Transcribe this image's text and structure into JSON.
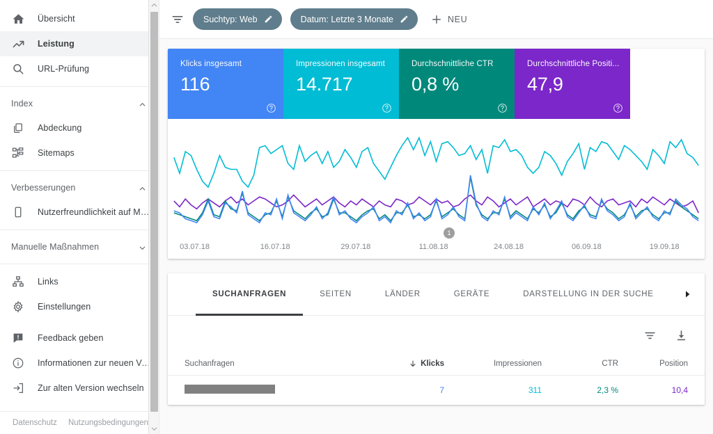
{
  "colors": {
    "clicks": "#4285F4",
    "impressions": "#00BCD4",
    "ctr": "#00897B",
    "position": "#7B27C9",
    "chip": "#5f7d8c",
    "sidebar_selected": "#f1f3f4"
  },
  "sidebar": {
    "items": [
      {
        "label": "Übersicht",
        "icon": "home-icon",
        "selected": false
      },
      {
        "label": "Leistung",
        "icon": "trending-up-icon",
        "selected": true
      },
      {
        "label": "URL-Prüfung",
        "icon": "search-icon",
        "selected": false
      }
    ],
    "groups": [
      {
        "title": "Index",
        "expanded": true,
        "items": [
          {
            "label": "Abdeckung",
            "icon": "pages-icon"
          },
          {
            "label": "Sitemaps",
            "icon": "sitemap-icon"
          }
        ]
      },
      {
        "title": "Verbesserungen",
        "expanded": true,
        "items": [
          {
            "label": "Nutzerfreundlichkeit auf Mo...",
            "icon": "mobile-icon"
          }
        ]
      },
      {
        "title": "Manuelle Maßnahmen",
        "expanded": false,
        "items": []
      }
    ],
    "bottom_items": [
      {
        "label": "Links",
        "icon": "links-icon"
      },
      {
        "label": "Einstellungen",
        "icon": "gear-icon"
      },
      {
        "label": "Feedback geben",
        "icon": "feedback-icon"
      },
      {
        "label": "Informationen zur neuen Ver...",
        "icon": "info-icon"
      },
      {
        "label": "Zur alten Version wechseln",
        "icon": "exit-icon"
      }
    ],
    "footer": {
      "privacy": "Datenschutz",
      "terms": "Nutzungsbedingungen"
    }
  },
  "filterbar": {
    "filter_icon": "filter-icon",
    "chips": [
      {
        "label": "Suchtyp: Web",
        "edit_icon": "pencil-icon"
      },
      {
        "label": "Datum: Letzte 3 Monate",
        "edit_icon": "pencil-icon"
      }
    ],
    "new_button": {
      "label": "NEU",
      "icon": "plus-icon"
    }
  },
  "metrics": [
    {
      "label": "Klicks insgesamt",
      "value": "116",
      "color": "#4285F4",
      "help_icon": "help-icon"
    },
    {
      "label": "Impressionen insgesamt",
      "value": "14.717",
      "color": "#00BCD4",
      "help_icon": "help-icon"
    },
    {
      "label": "Durchschnittliche CTR",
      "value": "0,8 %",
      "color": "#00897B",
      "help_icon": "help-icon"
    },
    {
      "label": "Durchschnittliche Positi...",
      "value": "47,9",
      "color": "#7B27C9",
      "help_icon": "help-icon"
    }
  ],
  "chart_data": {
    "type": "line",
    "title": "",
    "xlabel": "",
    "ylabel": "",
    "grid": false,
    "legend_position": "none",
    "annotations": [
      {
        "label": "1",
        "x_index": 53
      }
    ],
    "tick_labels": [
      "03.07.18",
      "16.07.18",
      "29.07.18",
      "11.08.18",
      "24.08.18",
      "06.09.18",
      "19.09.18"
    ],
    "tick_positions_pct": [
      5.0,
      20.0,
      35.0,
      49.5,
      63.5,
      78.0,
      92.5
    ],
    "series": [
      {
        "name": "Impressionen",
        "color": "#00BCD4",
        "values": [
          68,
          52,
          74,
          70,
          56,
          44,
          38,
          52,
          70,
          58,
          56,
          56,
          44,
          38,
          50,
          78,
          80,
          72,
          76,
          80,
          62,
          56,
          80,
          64,
          70,
          74,
          62,
          74,
          58,
          64,
          76,
          68,
          58,
          74,
          78,
          62,
          54,
          46,
          58,
          70,
          80,
          88,
          76,
          88,
          70,
          84,
          64,
          82,
          84,
          78,
          70,
          72,
          80,
          66,
          76,
          52,
          80,
          78,
          86,
          74,
          76,
          70,
          58,
          52,
          58,
          74,
          70,
          62,
          50,
          64,
          72,
          82,
          56,
          78,
          74,
          84,
          82,
          74,
          66,
          80,
          76,
          70,
          64,
          56,
          76,
          70,
          62,
          84,
          78,
          86,
          72,
          68,
          60
        ]
      },
      {
        "name": "Position",
        "color": "#7B27C9",
        "values": [
          24,
          18,
          26,
          20,
          16,
          22,
          26,
          22,
          18,
          24,
          28,
          22,
          26,
          20,
          24,
          28,
          26,
          22,
          18,
          20,
          24,
          30,
          24,
          18,
          22,
          26,
          20,
          24,
          28,
          22,
          18,
          24,
          20,
          26,
          22,
          18,
          24,
          20,
          18,
          26,
          24,
          20,
          22,
          28,
          24,
          20,
          26,
          22,
          24,
          18,
          20,
          26,
          30,
          24,
          20,
          28,
          24,
          18,
          22,
          26,
          20,
          24,
          28,
          18,
          22,
          26,
          20,
          24,
          22,
          18,
          26,
          24,
          20,
          28,
          22,
          18,
          24,
          26,
          20,
          22,
          24,
          18,
          26,
          22,
          28,
          24,
          20,
          26,
          22,
          18,
          20,
          24,
          12
        ]
      },
      {
        "name": "Klicks",
        "color": "#4285F4",
        "values": [
          14,
          12,
          6,
          4,
          2,
          10,
          24,
          8,
          6,
          22,
          18,
          12,
          34,
          10,
          6,
          2,
          12,
          10,
          26,
          6,
          30,
          12,
          8,
          4,
          10,
          18,
          6,
          12,
          28,
          10,
          14,
          6,
          2,
          8,
          12,
          18,
          4,
          8,
          2,
          14,
          10,
          22,
          6,
          12,
          4,
          8,
          26,
          6,
          10,
          18,
          8,
          4,
          50,
          22,
          8,
          4,
          14,
          10,
          28,
          6,
          12,
          8,
          4,
          18,
          10,
          22,
          6,
          14,
          24,
          8,
          4,
          12,
          20,
          8,
          6,
          26,
          14,
          10,
          4,
          8,
          22,
          6,
          12,
          18,
          8,
          4,
          14,
          10,
          26,
          20,
          16,
          8,
          4
        ]
      },
      {
        "name": "CTR",
        "color": "#00897B",
        "values": [
          12,
          10,
          8,
          6,
          4,
          12,
          26,
          10,
          8,
          24,
          16,
          14,
          32,
          12,
          8,
          4,
          10,
          12,
          24,
          8,
          28,
          14,
          10,
          6,
          12,
          16,
          8,
          10,
          26,
          12,
          12,
          8,
          4,
          10,
          14,
          16,
          6,
          10,
          4,
          12,
          12,
          20,
          8,
          10,
          6,
          10,
          24,
          8,
          12,
          16,
          10,
          6,
          48,
          20,
          10,
          6,
          12,
          12,
          26,
          8,
          14,
          10,
          6,
          16,
          12,
          20,
          8,
          12,
          22,
          10,
          6,
          14,
          18,
          10,
          8,
          24,
          16,
          12,
          6,
          10,
          20,
          8,
          14,
          16,
          10,
          6,
          12,
          12,
          24,
          18,
          14,
          10,
          6
        ]
      }
    ]
  },
  "bottom_panel": {
    "tabs": [
      {
        "label": "SUCHANFRAGEN",
        "active": true
      },
      {
        "label": "SEITEN",
        "active": false
      },
      {
        "label": "LÄNDER",
        "active": false
      },
      {
        "label": "GERÄTE",
        "active": false
      },
      {
        "label": "DARSTELLUNG IN DER SUCHE",
        "active": false
      }
    ],
    "next_tab_icon": "chevron-right-icon",
    "tools": [
      {
        "icon": "filter-icon",
        "name": "table-filter-button"
      },
      {
        "icon": "download-icon",
        "name": "table-download-button"
      }
    ],
    "table": {
      "columns": [
        {
          "label": "Suchanfragen",
          "align": "left",
          "sorted": false
        },
        {
          "label": "Klicks",
          "align": "right",
          "sorted": true,
          "sort_icon": "arrow-down-icon"
        },
        {
          "label": "Impressionen",
          "align": "right",
          "sorted": false
        },
        {
          "label": "CTR",
          "align": "right",
          "sorted": false
        },
        {
          "label": "Position",
          "align": "right",
          "sorted": false
        }
      ],
      "rows": [
        {
          "query": "",
          "redacted": true,
          "clicks": "7",
          "impressions": "311",
          "ctr": "2,3 %",
          "position": "10,4"
        }
      ]
    }
  }
}
